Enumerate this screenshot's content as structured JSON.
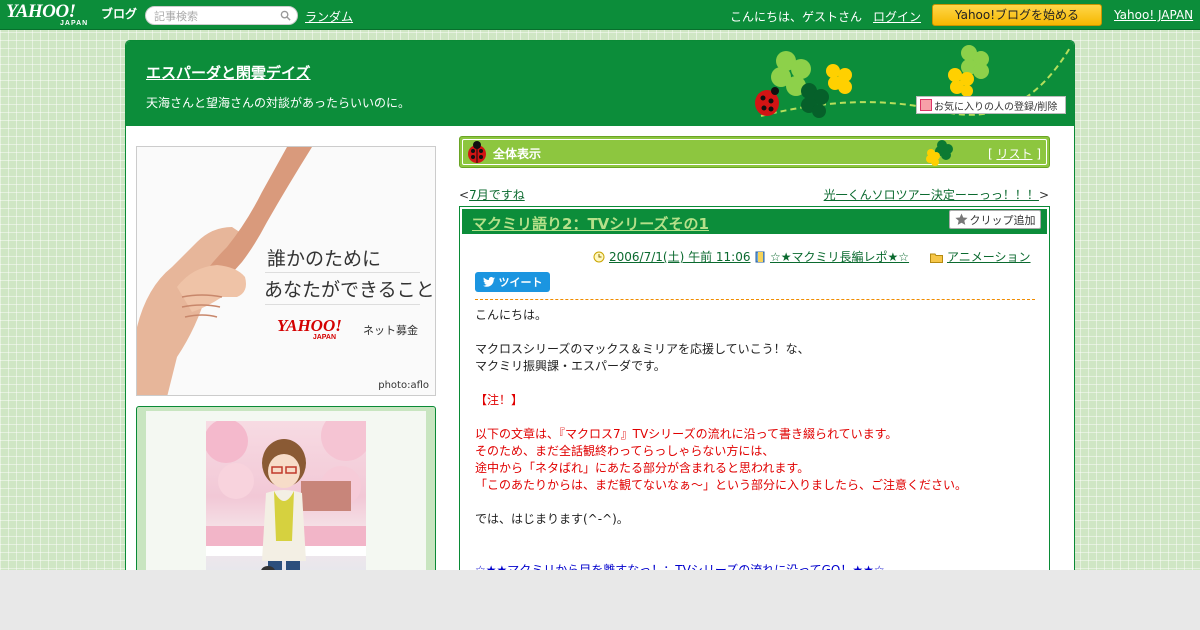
{
  "topbar": {
    "logo_main": "YAHOO!",
    "logo_sub": "JAPAN",
    "logo_blog": "ブログ",
    "search_placeholder": "記事検索",
    "random_link": "ランダム",
    "greeting": "こんにちは、ゲストさん",
    "login_link": "ログイン",
    "start_button": "Yahoo!ブログを始める",
    "yahoo_japan_link": "Yahoo! JAPAN"
  },
  "blog": {
    "title": "エスパーダと閑雲デイズ",
    "description": "天海さんと望海さんの対談があったらいいのに。",
    "fav_button": "お気に入りの人の登録/削除"
  },
  "ad": {
    "line1": "誰かのために",
    "line2": "あなたができること",
    "yahoo": "YAHOO!",
    "yahoo_sub": "JAPAN",
    "net": "ネット募金",
    "photo_credit": "photo:aflo"
  },
  "nav": {
    "title": "全体表示",
    "list_open": "[",
    "list_link": "リスト",
    "list_close": "]"
  },
  "pager": {
    "prev_arrow": "<",
    "prev": "7月ですね",
    "next": "光一くんソロツアー決定ーーっっ！！！",
    "next_arrow": ">"
  },
  "entry": {
    "title": "マクミリ語り2：TVシリーズその1",
    "clip_button": "クリップ追加",
    "date": "2006/7/1(土) 午前 11:06",
    "book": "☆★マクミリ長編レポ★☆",
    "category": "アニメーション",
    "tweet": "ツイート",
    "lines": [
      {
        "text": "こんにちは。",
        "color": ""
      },
      {
        "text": "",
        "color": ""
      },
      {
        "text": "マクロスシリーズのマックス＆ミリアを応援していこう！な、",
        "color": ""
      },
      {
        "text": "マクミリ振興課・エスパーダです。",
        "color": ""
      },
      {
        "text": "",
        "color": ""
      },
      {
        "text": "【注！】",
        "color": "red"
      },
      {
        "text": "",
        "color": ""
      },
      {
        "text": "以下の文章は、『マクロス7』TVシリーズの流れに沿って書き綴られています。",
        "color": "red"
      },
      {
        "text": "そのため、まだ全話観終わってらっしゃらない方には、",
        "color": "red"
      },
      {
        "text": "途中から「ネタばれ」にあたる部分が含まれると思われます。",
        "color": "red"
      },
      {
        "text": "「このあたりからは、まだ観てないなぁ～」という部分に入りましたら、ご注意ください。",
        "color": "red"
      },
      {
        "text": "",
        "color": ""
      },
      {
        "text": "では、はじまります(^-^)。",
        "color": ""
      },
      {
        "text": "",
        "color": ""
      },
      {
        "text": "",
        "color": ""
      },
      {
        "text": "☆★★マクミリから目を離すなっ！：TVシリーズの流れに沿ってGO！★★☆",
        "color": "blue"
      }
    ]
  },
  "colors": {
    "brand_green": "#0c8d3a",
    "nav_green": "#8dc63f",
    "button_yellow": "#f6b700"
  }
}
